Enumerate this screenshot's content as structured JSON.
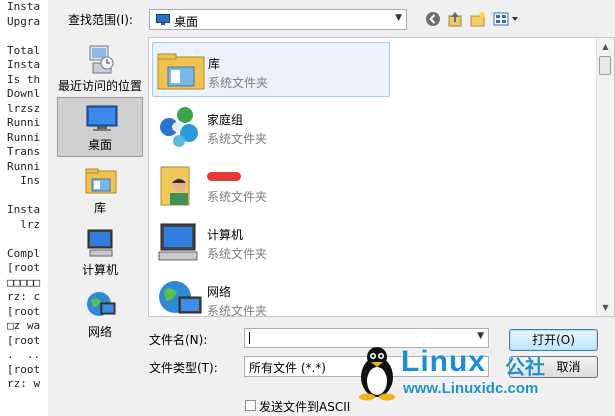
{
  "terminal": {
    "lines": [
      "Insta",
      "Upgra",
      "",
      "Total",
      "Insta",
      "Is th",
      "Downl",
      "lrzsz",
      "Runni",
      "Runni",
      "Trans",
      "Runni",
      "  Ins",
      "",
      "Insta",
      "  lrz",
      "",
      "Compl",
      "[root",
      "□□□□□",
      "rz: c",
      "[root",
      "□z wa",
      "[root",
      ".  ..",
      "[root",
      "rz: w"
    ]
  },
  "toolbar": {
    "lookin_label": "查找范围(I):",
    "lookin_value": "桌面",
    "icons": [
      "back-icon",
      "up-folder-icon",
      "new-folder-icon",
      "view-menu-icon"
    ]
  },
  "places": [
    {
      "label": "最近访问的位置",
      "icon": "recent-places-icon"
    },
    {
      "label": "桌面",
      "icon": "desktop-icon",
      "selected": true
    },
    {
      "label": "库",
      "icon": "libraries-icon"
    },
    {
      "label": "计算机",
      "icon": "computer-icon"
    },
    {
      "label": "网络",
      "icon": "network-icon"
    }
  ],
  "files": [
    {
      "name": "库",
      "type": "系统文件夹",
      "icon": "libraries-icon",
      "selected": true
    },
    {
      "name": "家庭组",
      "type": "系统文件夹",
      "icon": "homegroup-icon"
    },
    {
      "name": "",
      "type": "系统文件夹",
      "icon": "user-folder-icon",
      "redacted": true
    },
    {
      "name": "计算机",
      "type": "系统文件夹",
      "icon": "computer-icon"
    },
    {
      "name": "网络",
      "type": "系统文件夹",
      "icon": "network-icon"
    }
  ],
  "form": {
    "filename_label": "文件名(N):",
    "filename_value": "",
    "filetype_label": "文件类型(T):",
    "filetype_value": "所有文件 (*.*)",
    "open_button": "打开(O)",
    "cancel_button": "取消",
    "checkbox_label": "发送文件到ASCII",
    "checkbox_checked": false
  },
  "watermark": {
    "word": "Linux",
    "cn": "公社",
    "url": "www.Linuxidc.com"
  }
}
